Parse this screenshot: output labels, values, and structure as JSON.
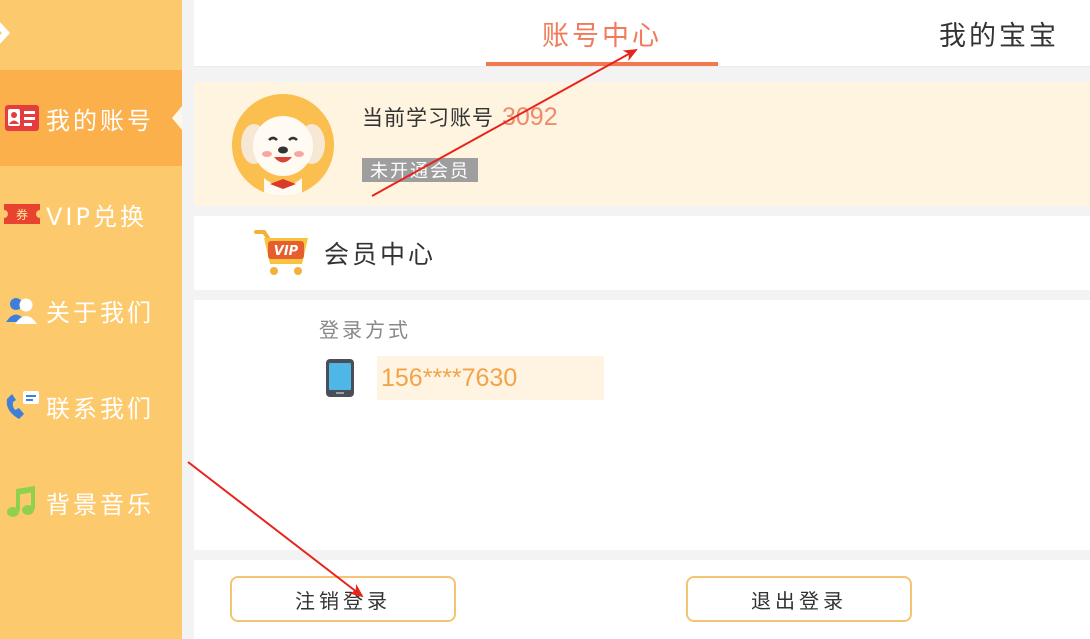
{
  "sidebar": {
    "items": [
      {
        "label": "我的账号",
        "icon": "account-card-icon",
        "active": true
      },
      {
        "label": "VIP兑换",
        "icon": "coupon-icon",
        "active": false
      },
      {
        "label": "关于我们",
        "icon": "people-icon",
        "active": false
      },
      {
        "label": "联系我们",
        "icon": "phone-message-icon",
        "active": false
      },
      {
        "label": "背景音乐",
        "icon": "music-note-icon",
        "active": false
      }
    ]
  },
  "header": {
    "tabs": [
      {
        "label": "账号中心",
        "active": true
      },
      {
        "label": "我的宝宝",
        "active": false
      }
    ]
  },
  "profile": {
    "account_label": "当前学习账号",
    "account_id": "3092",
    "member_status": "未开通会员"
  },
  "vip": {
    "icon_text": "VIP",
    "label": "会员中心"
  },
  "login": {
    "title": "登录方式",
    "phone": "156****7630"
  },
  "actions": {
    "cancel_account": "注销登录",
    "logout": "退出登录"
  },
  "colors": {
    "sidebar": "#fcca6d",
    "sidebar_active": "#fbb04b",
    "accent": "#f4784f",
    "profile_bg": "#fff4e0",
    "annotation_arrow": "#e8231c"
  }
}
